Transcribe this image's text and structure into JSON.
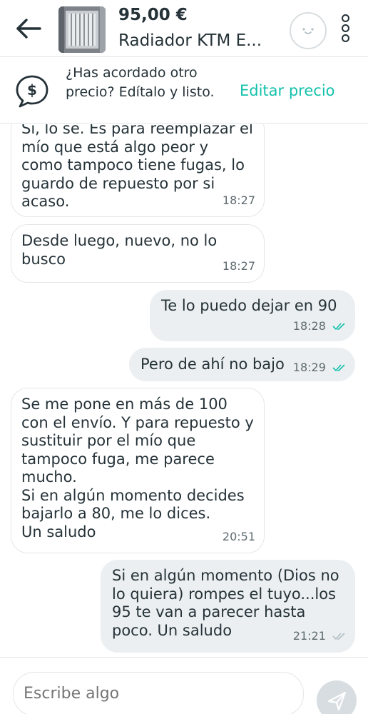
{
  "header": {
    "price": "95,00 €",
    "title": "Radiador KTM E..."
  },
  "banner": {
    "text": "¿Has acordado otro precio? Edítalo y listo.",
    "link": "Editar precio"
  },
  "messages": [
    {
      "dir": "in",
      "text": "Sí, lo sé. Es para reemplazar el mío que está algo peor y como tampoco tiene fugas, lo guardo de repuesto por si acaso.",
      "time": "18:27"
    },
    {
      "dir": "in",
      "text": "Desde luego, nuevo, no lo busco",
      "time": "18:27"
    },
    {
      "dir": "out",
      "text": "Te lo puedo dejar en 90",
      "time": "18:28",
      "status": "read"
    },
    {
      "dir": "out",
      "text": "Pero de ahí no bajo",
      "time": "18:29",
      "status": "read"
    },
    {
      "dir": "in",
      "text": "Se me pone en más de 100 con el envío. Y para repuesto y sustituir por el mío que tampoco fuga, me parece mucho.\nSi en algún momento decides bajarlo a 80, me lo dices.\nUn saludo",
      "time": "20:51"
    },
    {
      "dir": "out",
      "text": "Si en algún momento (Dios no lo quiera) rompes el tuyo...los 95 te van a parecer hasta poco. Un saludo",
      "time": "21:21",
      "status": "sent"
    }
  ],
  "composer": {
    "placeholder": "Escribe algo"
  },
  "colors": {
    "accent": "#13c1ac",
    "read_ticks": "#13c1ac",
    "sent_ticks": "#b0bec5"
  }
}
